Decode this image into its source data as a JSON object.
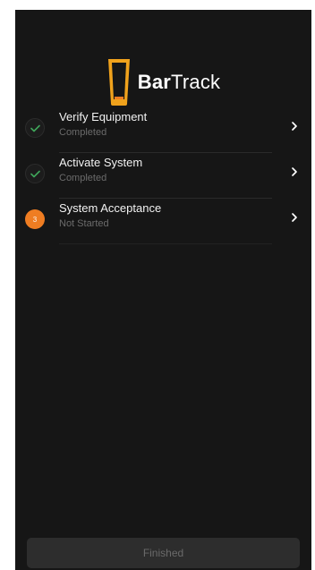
{
  "app": {
    "logo_bold": "Bar",
    "logo_light": "Track"
  },
  "steps": [
    {
      "title": "Verify Equipment",
      "status": "Completed",
      "state": "done",
      "icon": "check-icon"
    },
    {
      "title": "Activate System",
      "status": "Completed",
      "state": "done",
      "icon": "check-icon"
    },
    {
      "title": "System Acceptance",
      "status": "Not Started",
      "state": "active",
      "number": "3",
      "icon": "chevron-right-icon"
    }
  ],
  "footer": {
    "finish_label": "Finished"
  },
  "colors": {
    "background": "#161616",
    "accent": "#ef7d22",
    "check": "#3fa55a",
    "text_primary": "#f2f2f2",
    "text_secondary": "#6b6b6b",
    "button_disabled": "#2d2d2d"
  }
}
